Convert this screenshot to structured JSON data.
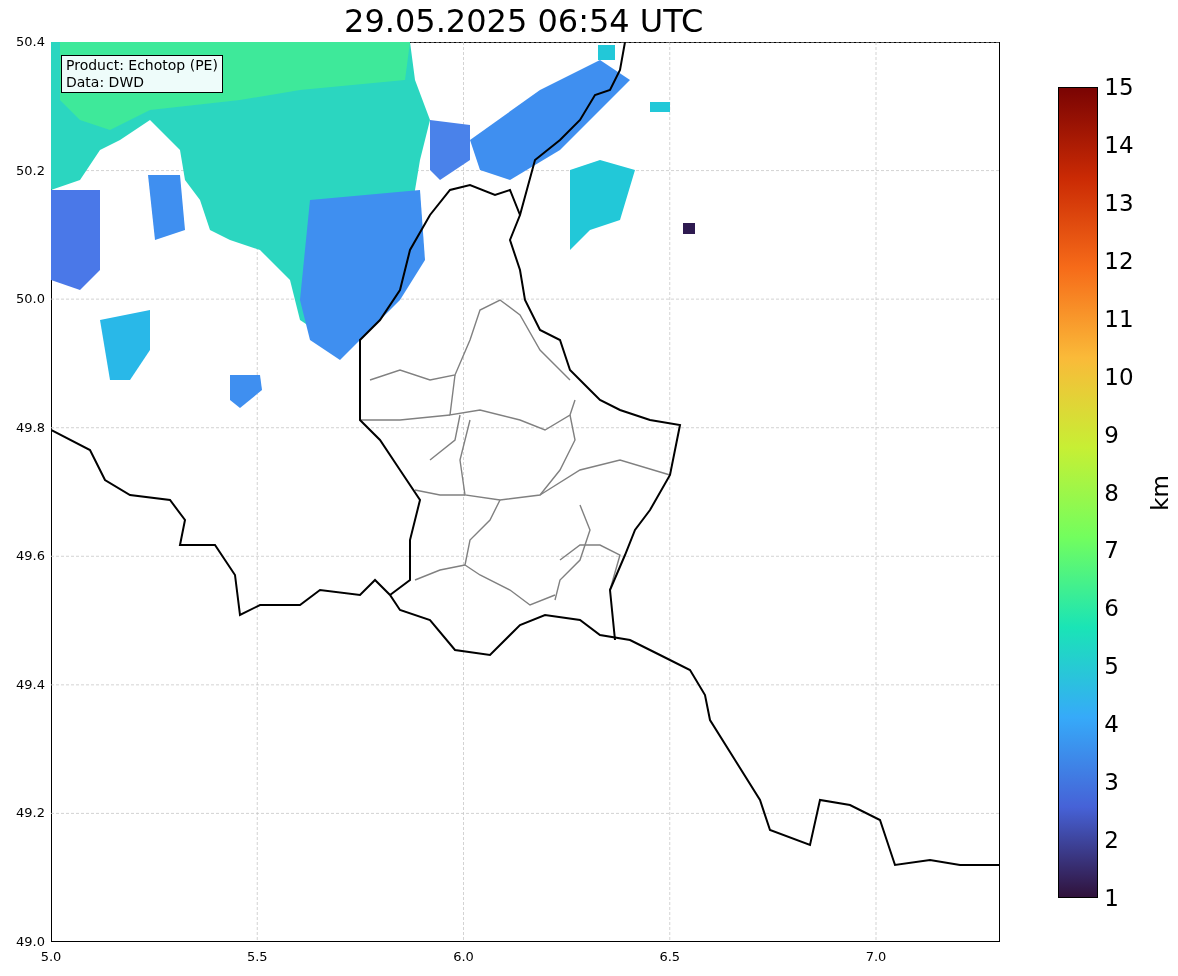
{
  "title": "29.05.2025 06:54 UTC",
  "map": {
    "info_lines": [
      "Product: Echotop (PE)",
      "Data: DWD"
    ],
    "yticks": [
      "50.4",
      "50.2",
      "50.0",
      "49.8",
      "49.6",
      "49.4",
      "49.2",
      "49.0"
    ],
    "xticks": [
      "5.0",
      "5.5",
      "6.0",
      "6.5",
      "7.0"
    ]
  },
  "colorbar": {
    "ticks": [
      "15",
      "14",
      "13",
      "12",
      "11",
      "10",
      "9",
      "8",
      "7",
      "6",
      "5",
      "4",
      "3",
      "2",
      "1"
    ],
    "label": "km"
  }
}
